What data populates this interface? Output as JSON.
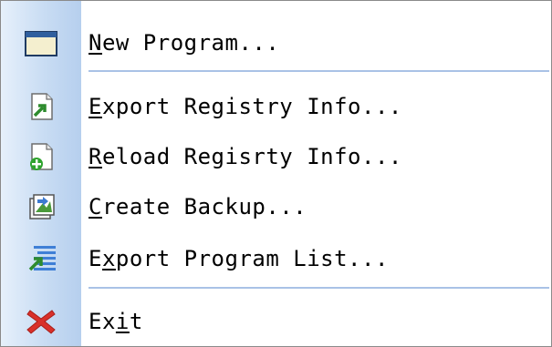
{
  "menu": {
    "items": [
      {
        "key": "N",
        "label": "New Program...",
        "mnemonic_index": 0,
        "icon": "window-icon"
      },
      {
        "key": "E",
        "label": "Export Registry Info...",
        "mnemonic_index": 0,
        "icon": "export-registry-icon"
      },
      {
        "key": "R",
        "label": "Reload Regisrty Info...",
        "mnemonic_index": 0,
        "icon": "reload-registry-icon"
      },
      {
        "key": "C",
        "label": "Create Backup...",
        "mnemonic_index": 0,
        "icon": "backup-icon"
      },
      {
        "key": "x",
        "label": "Export Program List...",
        "mnemonic_index": 1,
        "icon": "export-list-icon"
      },
      {
        "key": "i",
        "label": "Exit",
        "mnemonic_index": 2,
        "icon": "exit-icon"
      }
    ]
  },
  "colors": {
    "strip_accent": "#b6cfee",
    "separator": "#a9c2e6",
    "exit_red": "#d9302a",
    "arrow_green": "#3aa03a"
  }
}
